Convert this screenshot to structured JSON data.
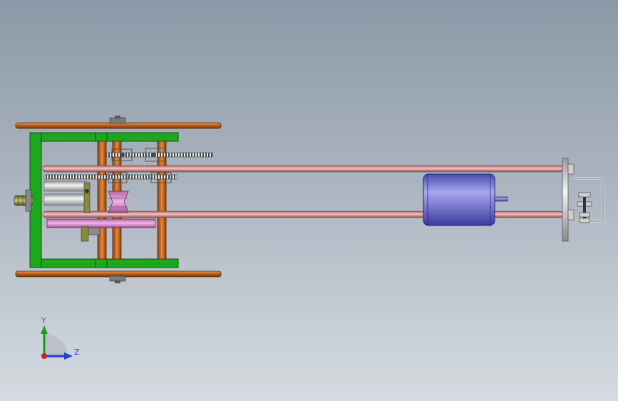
{
  "viewport": {
    "background_top": "#8d99a8",
    "background_bottom": "#d6dbe1"
  },
  "triad": {
    "y_label": "Y",
    "z_label": "Z",
    "y_color": "#1f9a1f",
    "z_color": "#1f3fd0",
    "origin_color": "#d21d1d"
  },
  "colors": {
    "frame_green": "#1ea71e",
    "copper": "#c0621a",
    "rod_pink": "#d88a8a",
    "motor_blue": "#6f6fd8",
    "pulley_pink": "#d98ac8",
    "chain_gray": "#6c6c6c",
    "bracket_silver": "#d7d7d7",
    "shaft_olive": "#8a8a3a"
  }
}
